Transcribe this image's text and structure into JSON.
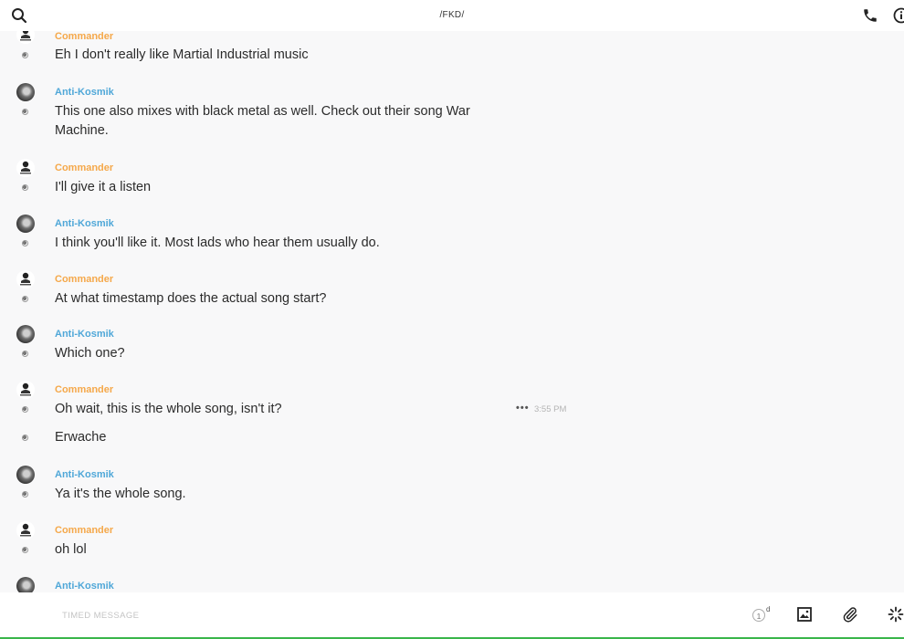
{
  "header": {
    "title": "/FKD/"
  },
  "messages": [
    {
      "sender": "Commander",
      "text": "Eh I don't really like Martial Industrial music"
    },
    {
      "sender": "Anti-Kosmik",
      "text": "This one also mixes with black metal as well. Check out their song War Machine."
    },
    {
      "sender": "Commander",
      "text": "I'll give it a listen"
    },
    {
      "sender": "Anti-Kosmik",
      "text": "I think you'll like it. Most lads who hear them usually do."
    },
    {
      "sender": "Commander",
      "text": "At what timestamp does the actual song start?"
    },
    {
      "sender": "Anti-Kosmik",
      "text": "Which one?"
    },
    {
      "sender": "Commander",
      "text": "Oh wait, this is the whole song, isn't it?",
      "more": "•••",
      "time": "3:55 PM"
    },
    {
      "text": "Erwache"
    },
    {
      "sender": "Anti-Kosmik",
      "text": "Ya it's the whole song."
    },
    {
      "sender": "Commander",
      "text": "oh lol"
    },
    {
      "sender": "Anti-Kosmik"
    }
  ],
  "composer": {
    "placeholder": "TIMED MESSAGE",
    "timer_value": "1",
    "timer_unit": "d"
  },
  "colors": {
    "commander": "#f5a84a",
    "anti_kosmik": "#4fa7d8",
    "accent_line": "#39b54a"
  },
  "icons": [
    "search-icon",
    "phone-icon",
    "info-icon",
    "timer-icon",
    "image-icon",
    "paperclip-icon",
    "giphy-icon"
  ]
}
